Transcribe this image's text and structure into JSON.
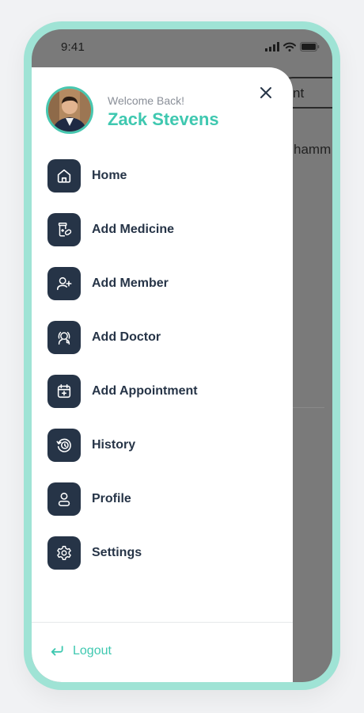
{
  "status_bar": {
    "time": "9:41"
  },
  "background": {
    "pill_label": "nt",
    "text": "hamm"
  },
  "drawer": {
    "welcome": "Welcome Back!",
    "user_name": "Zack Stevens",
    "menu": [
      {
        "label": "Home",
        "icon": "home-icon"
      },
      {
        "label": "Add Medicine",
        "icon": "medicine-icon"
      },
      {
        "label": "Add Member",
        "icon": "add-member-icon"
      },
      {
        "label": "Add Doctor",
        "icon": "doctor-icon"
      },
      {
        "label": "Add Appointment",
        "icon": "calendar-plus-icon"
      },
      {
        "label": "History",
        "icon": "history-icon"
      },
      {
        "label": "Profile",
        "icon": "profile-icon"
      },
      {
        "label": "Settings",
        "icon": "gear-icon"
      }
    ],
    "logout_label": "Logout"
  },
  "colors": {
    "accent": "#3fc8b0",
    "frame": "#9fe3d5",
    "icon_bg": "#263447",
    "overlay": "#7a7a7a"
  }
}
